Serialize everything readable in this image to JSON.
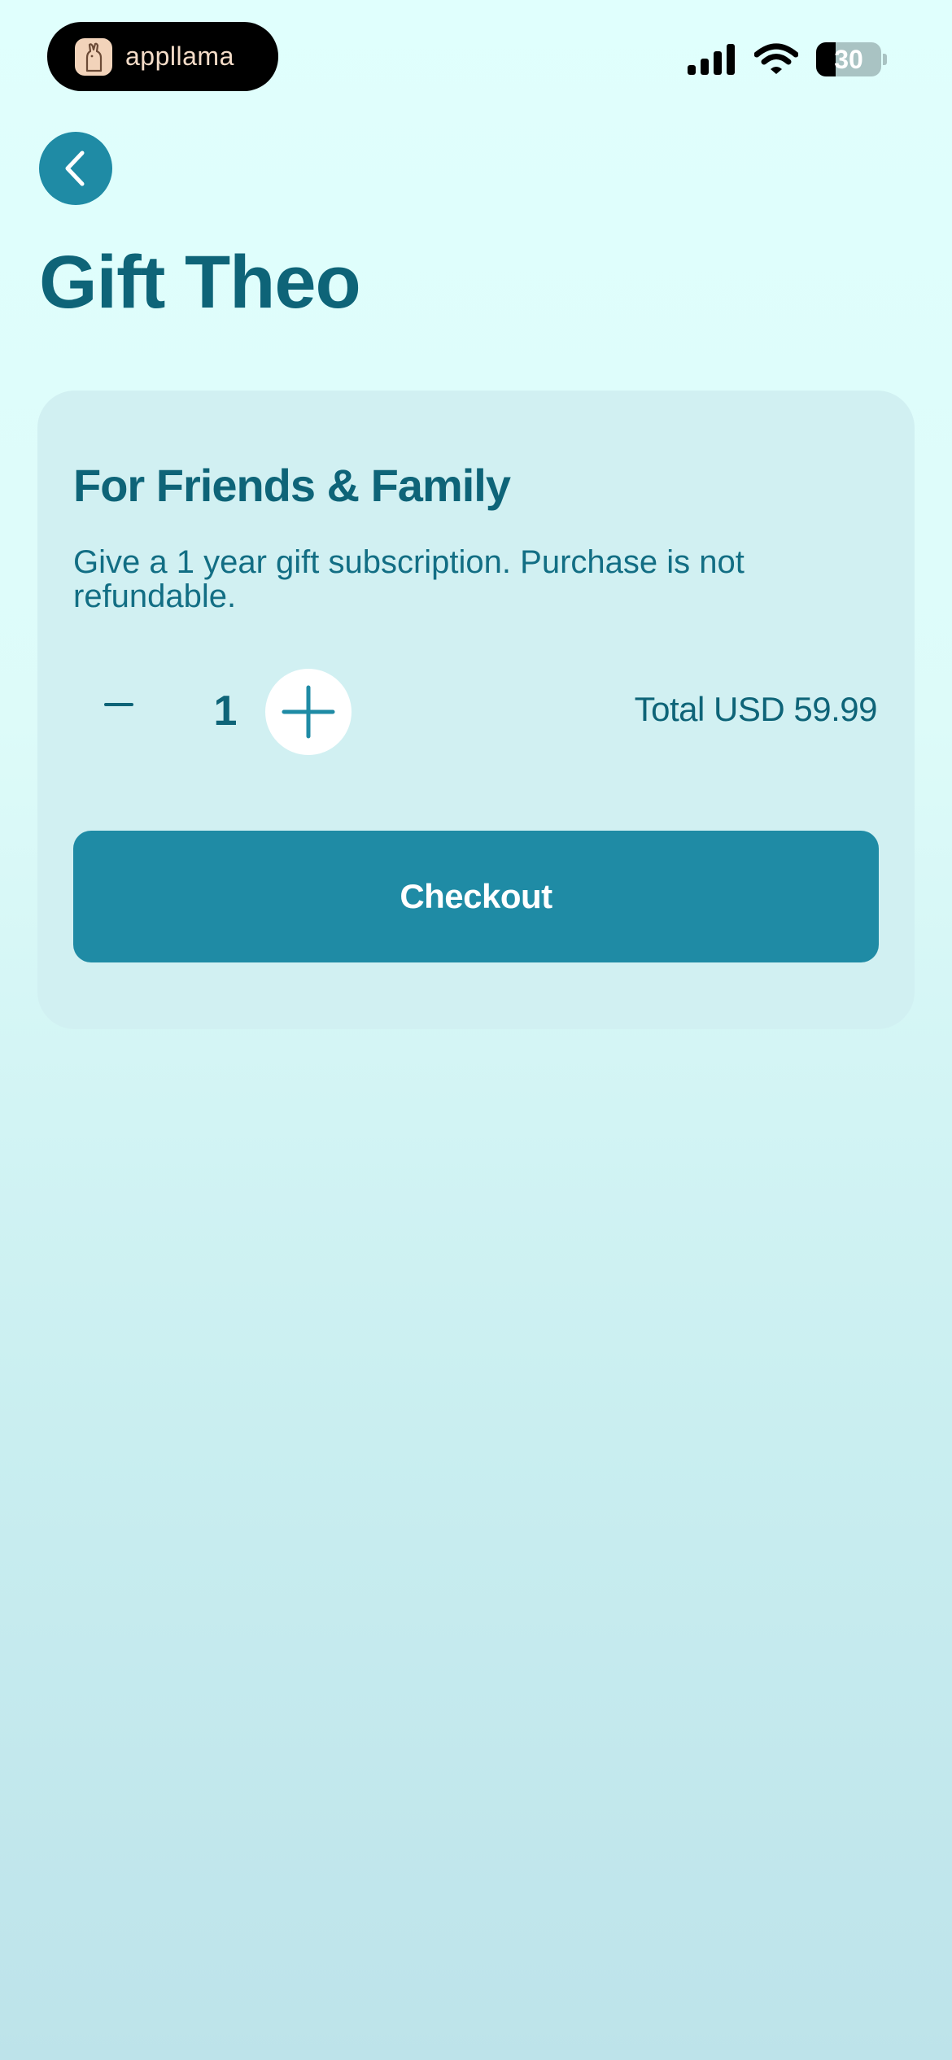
{
  "status_bar": {
    "app_logo_text": "appllama",
    "battery_level": "30"
  },
  "header": {
    "back_icon": "chevron-left-icon",
    "title": "Gift Theo"
  },
  "gift_card": {
    "title": "For Friends & Family",
    "description": "Give a 1 year gift subscription. Purchase is not refundable.",
    "quantity": "1",
    "total_label": "Total USD 59.99",
    "checkout_label": "Checkout"
  },
  "colors": {
    "accent": "#1f8ba5",
    "text_primary": "#0e6478",
    "card_background": "#d1f0f2",
    "page_background_top": "#e0fffd",
    "page_background_bottom": "#bde3ea"
  }
}
